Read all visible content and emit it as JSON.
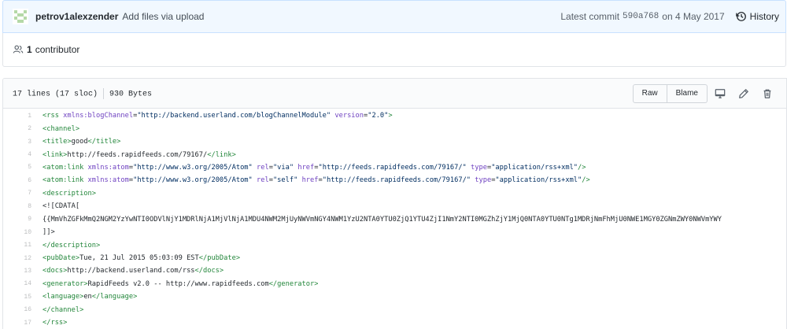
{
  "commit": {
    "author": "petrov1alexzender",
    "message": "Add files via upload",
    "latest_label": "Latest commit",
    "sha": "590a768",
    "date_text": "on 4 May 2017",
    "history_label": "History"
  },
  "contributors": {
    "count": "1",
    "label": "contributor"
  },
  "file": {
    "lines_info": "17 lines (17 sloc)",
    "size": "930 Bytes",
    "raw_label": "Raw",
    "blame_label": "Blame"
  },
  "code_lines": [
    {
      "n": "1",
      "parts": [
        [
          "t",
          "<rss "
        ],
        [
          "a",
          "xmlns:blogChannel"
        ],
        [
          "p",
          "="
        ],
        [
          "s",
          "\"http://backend.userland.com/blogChannelModule\""
        ],
        [
          "p",
          " "
        ],
        [
          "a",
          "version"
        ],
        [
          "p",
          "="
        ],
        [
          "s",
          "\"2.0\""
        ],
        [
          "t",
          ">"
        ]
      ]
    },
    {
      "n": "2",
      "parts": [
        [
          "t",
          "<channel>"
        ]
      ]
    },
    {
      "n": "3",
      "parts": [
        [
          "t",
          "<title>"
        ],
        [
          "p",
          "good"
        ],
        [
          "t",
          "</title>"
        ]
      ]
    },
    {
      "n": "4",
      "parts": [
        [
          "t",
          "<link>"
        ],
        [
          "p",
          "http://feeds.rapidfeeds.com/79167/"
        ],
        [
          "t",
          "</link>"
        ]
      ]
    },
    {
      "n": "5",
      "parts": [
        [
          "t",
          "<atom:link "
        ],
        [
          "a",
          "xmlns:atom"
        ],
        [
          "p",
          "="
        ],
        [
          "s",
          "\"http://www.w3.org/2005/Atom\""
        ],
        [
          "p",
          " "
        ],
        [
          "a",
          "rel"
        ],
        [
          "p",
          "="
        ],
        [
          "s",
          "\"via\""
        ],
        [
          "p",
          " "
        ],
        [
          "a",
          "href"
        ],
        [
          "p",
          "="
        ],
        [
          "s",
          "\"http://feeds.rapidfeeds.com/79167/\""
        ],
        [
          "p",
          " "
        ],
        [
          "a",
          "type"
        ],
        [
          "p",
          "="
        ],
        [
          "s",
          "\"application/rss+xml\""
        ],
        [
          "t",
          "/>"
        ]
      ]
    },
    {
      "n": "6",
      "parts": [
        [
          "t",
          "<atom:link "
        ],
        [
          "a",
          "xmlns:atom"
        ],
        [
          "p",
          "="
        ],
        [
          "s",
          "\"http://www.w3.org/2005/Atom\""
        ],
        [
          "p",
          " "
        ],
        [
          "a",
          "rel"
        ],
        [
          "p",
          "="
        ],
        [
          "s",
          "\"self\""
        ],
        [
          "p",
          " "
        ],
        [
          "a",
          "href"
        ],
        [
          "p",
          "="
        ],
        [
          "s",
          "\"http://feeds.rapidfeeds.com/79167/\""
        ],
        [
          "p",
          " "
        ],
        [
          "a",
          "type"
        ],
        [
          "p",
          "="
        ],
        [
          "s",
          "\"application/rss+xml\""
        ],
        [
          "t",
          "/>"
        ]
      ]
    },
    {
      "n": "7",
      "parts": [
        [
          "t",
          "<description>"
        ]
      ]
    },
    {
      "n": "8",
      "parts": [
        [
          "p",
          "<![CDATA["
        ]
      ]
    },
    {
      "n": "9",
      "parts": [
        [
          "p",
          "{{MmVhZGFkMmQ2NGM2YzYwNTI0ODVlNjY1MDRlNjA1MjVlNjA1MDU4NWM2MjUyNWVmNGY4NWM1YzU2NTA0YTU0ZjQ1YTU4ZjI1NmY2NTI0MGZhZjY1MjQ0NTA0YTU0NTg1MDRjNmFhMjU0NWE1MGY0ZGNmZWY0NWVmYWY"
        ]
      ]
    },
    {
      "n": "10",
      "parts": [
        [
          "p",
          "]]>"
        ]
      ]
    },
    {
      "n": "11",
      "parts": [
        [
          "t",
          "</description>"
        ]
      ]
    },
    {
      "n": "12",
      "parts": [
        [
          "t",
          "<pubDate>"
        ],
        [
          "p",
          "Tue, 21 Jul 2015 05:03:09 EST"
        ],
        [
          "t",
          "</pubDate>"
        ]
      ]
    },
    {
      "n": "13",
      "parts": [
        [
          "t",
          "<docs>"
        ],
        [
          "p",
          "http://backend.userland.com/rss"
        ],
        [
          "t",
          "</docs>"
        ]
      ]
    },
    {
      "n": "14",
      "parts": [
        [
          "t",
          "<generator>"
        ],
        [
          "p",
          "RapidFeeds v2.0 -- http://www.rapidfeeds.com"
        ],
        [
          "t",
          "</generator>"
        ]
      ]
    },
    {
      "n": "15",
      "parts": [
        [
          "t",
          "<language>"
        ],
        [
          "p",
          "en"
        ],
        [
          "t",
          "</language>"
        ]
      ]
    },
    {
      "n": "16",
      "parts": [
        [
          "t",
          "</channel>"
        ]
      ]
    },
    {
      "n": "17",
      "parts": [
        [
          "t",
          "</rss>"
        ]
      ]
    }
  ],
  "colors": {
    "tag": "#22863a",
    "attr": "#6f42c1",
    "string": "#032f62",
    "commit_bg": "#f1f8ff"
  },
  "icons": [
    "avatar",
    "history-icon",
    "people-icon",
    "desktop-icon",
    "pencil-icon",
    "trash-icon"
  ]
}
